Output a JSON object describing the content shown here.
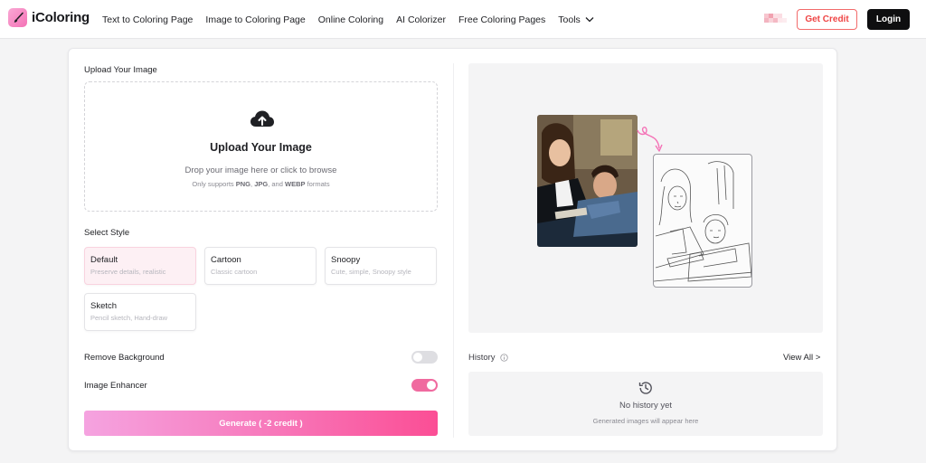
{
  "header": {
    "logo_text": "iColoring",
    "nav": [
      {
        "label": "Text to Coloring Page"
      },
      {
        "label": "Image to Coloring Page"
      },
      {
        "label": "Online Coloring"
      },
      {
        "label": "AI Colorizer"
      },
      {
        "label": "Free Coloring Pages"
      },
      {
        "label": "Tools"
      }
    ],
    "get_credit_label": "Get Credit",
    "login_label": "Login"
  },
  "upload": {
    "section_label": "Upload Your Image",
    "title": "Upload Your Image",
    "subtitle": "Drop your image here or click to browse",
    "formats_prefix": "Only supports",
    "format_1": "PNG",
    "format_sep_1": ", ",
    "format_2": "JPG",
    "format_sep_2": ", and",
    "format_3": "WEBP",
    "formats_suffix": "formats"
  },
  "style": {
    "section_label": "Select Style",
    "options": [
      {
        "name": "Default",
        "desc": "Preserve details, realistic",
        "selected": true
      },
      {
        "name": "Cartoon",
        "desc": "Classic cartoon",
        "selected": false
      },
      {
        "name": "Snoopy",
        "desc": "Cute, simple, Snoopy style",
        "selected": false
      },
      {
        "name": "Sketch",
        "desc": "Pencil sketch, Hand-draw",
        "selected": false
      }
    ]
  },
  "options": {
    "remove_background": {
      "label": "Remove Background",
      "enabled": false
    },
    "image_enhancer": {
      "label": "Image Enhancer",
      "enabled": true
    }
  },
  "generate_label": "Generate ( -2 credit )",
  "history": {
    "title": "History",
    "view_all": "View All >",
    "empty": "No history yet",
    "hint": "Generated images will appear here"
  },
  "colors": {
    "accent_pink": "#f06a9f",
    "credit_red": "#ef4444",
    "login_black": "#0e0e10"
  },
  "icons": {
    "logo": "brush-icon",
    "tools_dropdown": "chevron-down-icon",
    "upload": "cloud-upload-icon",
    "history_info": "info-icon",
    "history_empty": "history-clock-icon",
    "preview_arrow": "curved-arrow-icon"
  }
}
